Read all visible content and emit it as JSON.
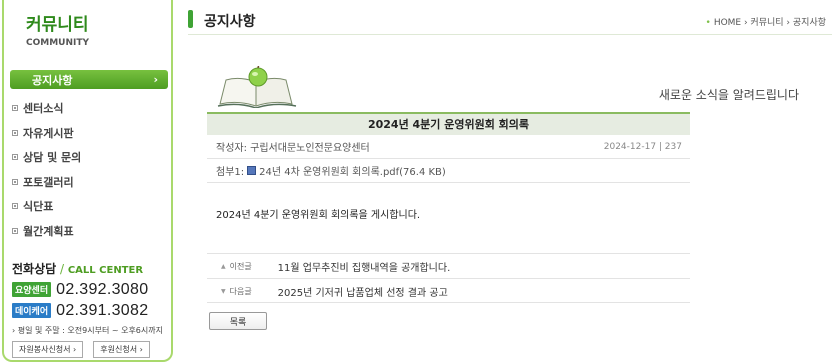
{
  "sidebar": {
    "brand_ko": "커뮤니티",
    "brand_en": "COMMUNITY",
    "active_item": "공지사항",
    "items": [
      "센터소식",
      "자유게시판",
      "상담 및 문의",
      "포토갤러리",
      "식단표",
      "월간계획표"
    ],
    "call": {
      "title_ko": "전화상담",
      "slash": " / ",
      "title_en": "CALL CENTER",
      "lines": [
        {
          "badge": "요양센터",
          "number": "02.392.3080",
          "color": "#3fa335"
        },
        {
          "badge": "데이케어",
          "number": "02.391.3082",
          "color": "#2a7cc7"
        }
      ],
      "hours": "› 평일 및 주말 : 오전9시부터 ~ 오후6시까지",
      "buttons": [
        "자원봉사신청서 ›",
        "후원신청서 ›"
      ]
    }
  },
  "header": {
    "title": "공지사항",
    "breadcrumb": "HOME › 커뮤니티 › 공지사항"
  },
  "slogan": "새로운 소식을 알려드립니다",
  "post": {
    "title": "2024년 4분기 운영위원회 회의록",
    "author": "작성자: 구립서대문노인전문요양센터",
    "date_views": "2024-12-17 | 237",
    "attachment_label": "첨부1:",
    "attachment_name": "24년 4차 운영위원회 회의록.pdf(76.4 KB)",
    "body": "2024년 4분기 운영위원회 회의록을 게시합니다."
  },
  "navigation": {
    "prev_label": "이전글",
    "prev_title": "11월 업무추진비 집행내역을 공개합니다.",
    "next_label": "다음글",
    "next_title": "2025년 기저귀 납품업체 선정 결과 공고"
  },
  "list_button": "목록",
  "colors": {
    "accent_green": "#3fa335",
    "accent_blue": "#2a7cc7"
  }
}
